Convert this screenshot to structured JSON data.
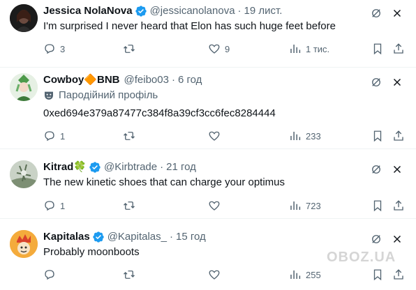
{
  "tweets": [
    {
      "name": "Jessica NolaNova",
      "handle": "@jessicanolanova",
      "time": "19 лист.",
      "verified": true,
      "text": "I'm surprised I never heard that Elon has such huge feet before",
      "replies": "3",
      "reposts": "",
      "likes": "9",
      "views": "1 тис."
    },
    {
      "name": "Cowboy🔶BNB",
      "handle": "@feibo03",
      "time": "6 год",
      "verified": false,
      "parody_label": "Пародійний профіль",
      "text": "0xed694e379a87477c384f8a39cf3cc6fec8284444",
      "replies": "1",
      "reposts": "",
      "likes": "",
      "views": "233"
    },
    {
      "name": "Kitrad🍀",
      "handle": "@Kirbtrade",
      "time": "21 год",
      "verified": true,
      "text": "The new kinetic shoes that can charge your optimus",
      "replies": "1",
      "reposts": "",
      "likes": "",
      "views": "723"
    },
    {
      "name": "Kapitalas",
      "handle": "@Kapitalas_",
      "time": "15 год",
      "verified": true,
      "text": "Probably moonboots",
      "replies": "",
      "reposts": "",
      "likes": "",
      "views": "255"
    }
  ],
  "watermark": "OBOZ.UA",
  "colors": {
    "accent": "#1d9bf0",
    "muted": "#536471",
    "text": "#0f1419",
    "divider": "#eff3f4"
  },
  "icons": [
    "grok-icon",
    "more-icon",
    "reply-icon",
    "repost-icon",
    "like-icon",
    "views-icon",
    "bookmark-icon",
    "share-icon",
    "verified-badge-icon",
    "parody-mask-icon"
  ]
}
